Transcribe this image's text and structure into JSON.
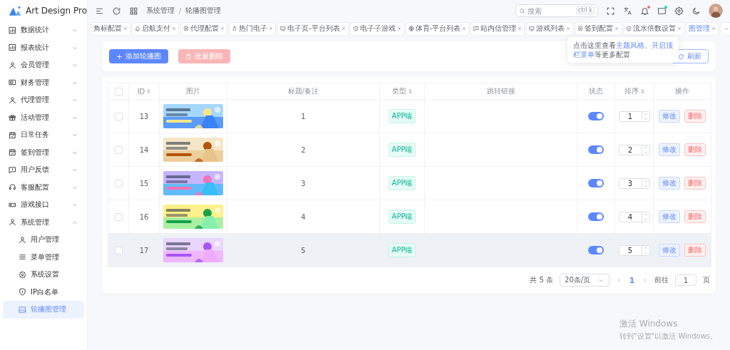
{
  "brand": {
    "name": "Art Design Pro"
  },
  "sidebar": {
    "items": [
      {
        "label": "数据统计",
        "expanded": false
      },
      {
        "label": "报表统计",
        "expanded": false
      },
      {
        "label": "会员管理",
        "expanded": false
      },
      {
        "label": "财务管理",
        "expanded": false
      },
      {
        "label": "代理管理",
        "expanded": false
      },
      {
        "label": "活动管理",
        "expanded": false
      },
      {
        "label": "日常任务",
        "expanded": false
      },
      {
        "label": "签到管理",
        "expanded": false
      },
      {
        "label": "用户反馈",
        "expanded": false
      },
      {
        "label": "客服配置",
        "expanded": false
      },
      {
        "label": "游戏接口",
        "expanded": false
      },
      {
        "label": "系统管理",
        "expanded": true,
        "children": [
          {
            "label": "用户管理",
            "selected": false
          },
          {
            "label": "菜单管理",
            "selected": false
          },
          {
            "label": "系统设置",
            "selected": false
          },
          {
            "label": "IP白名单",
            "selected": false
          },
          {
            "label": "轮播图管理",
            "selected": true
          }
        ]
      }
    ]
  },
  "breadcrumb": [
    "系统管理",
    "轮播图管理"
  ],
  "breadcrumb_separator": "/",
  "search": {
    "placeholder": "搜索",
    "shortcut": "ctrl k"
  },
  "notifications": {
    "unread": true
  },
  "messages": {
    "unread": true
  },
  "tabs": [
    {
      "label": "角标配置",
      "selected": false
    },
    {
      "label": "启航支付",
      "selected": false
    },
    {
      "label": "代理配置",
      "selected": false
    },
    {
      "label": "热门电子",
      "selected": false
    },
    {
      "label": "电子页-平台列表",
      "selected": false
    },
    {
      "label": "电子子游戏",
      "selected": false
    },
    {
      "label": "体育-平台列表",
      "selected": false
    },
    {
      "label": "站内信管理",
      "selected": false
    },
    {
      "label": "游戏列表",
      "selected": false
    },
    {
      "label": "签到配置",
      "selected": false
    },
    {
      "label": "流水倍数设置",
      "selected": false
    },
    {
      "label": "图管理",
      "selected": true
    }
  ],
  "tooltip": {
    "text": "点击这里查看**主题风格**、**开启顶栏菜单**等更多配置"
  },
  "toolbar": {
    "add_button": "添加轮播图",
    "batch_delete_button": "批量删除",
    "batch_delete_disabled": true,
    "refresh_button": "刷新"
  },
  "table": {
    "all_checked": false,
    "columns": [
      "ID",
      "图片",
      "标题/备注",
      "类型",
      "跳转链接",
      "状态",
      "排序",
      "操作"
    ],
    "rows": [
      {
        "checked": false,
        "id": "13",
        "title": "1",
        "type": "APP端",
        "enabled": true,
        "sort": "1",
        "edit": "修改",
        "delete": "删除",
        "hovered": false
      },
      {
        "checked": false,
        "id": "14",
        "title": "2",
        "type": "APP端",
        "enabled": true,
        "sort": "2",
        "edit": "修改",
        "delete": "删除",
        "hovered": false
      },
      {
        "checked": false,
        "id": "15",
        "title": "3",
        "type": "APP端",
        "enabled": true,
        "sort": "3",
        "edit": "修改",
        "delete": "删除",
        "hovered": false
      },
      {
        "checked": false,
        "id": "16",
        "title": "4",
        "type": "APP端",
        "enabled": true,
        "sort": "4",
        "edit": "修改",
        "delete": "删除",
        "hovered": false
      },
      {
        "checked": false,
        "id": "17",
        "title": "5",
        "type": "APP端",
        "enabled": true,
        "sort": "5",
        "edit": "修改",
        "delete": "删除",
        "hovered": true
      }
    ]
  },
  "pagination": {
    "total": "共 5 条",
    "page_size": "20条/页",
    "pages": [
      {
        "label": "1",
        "selected": true
      }
    ],
    "goto_label": "前往",
    "goto_value": "1",
    "goto_suffix": "页"
  },
  "os_notice": {
    "title": "激活 Windows",
    "subtitle": "转到\"设置\"以激活 Windows。"
  }
}
